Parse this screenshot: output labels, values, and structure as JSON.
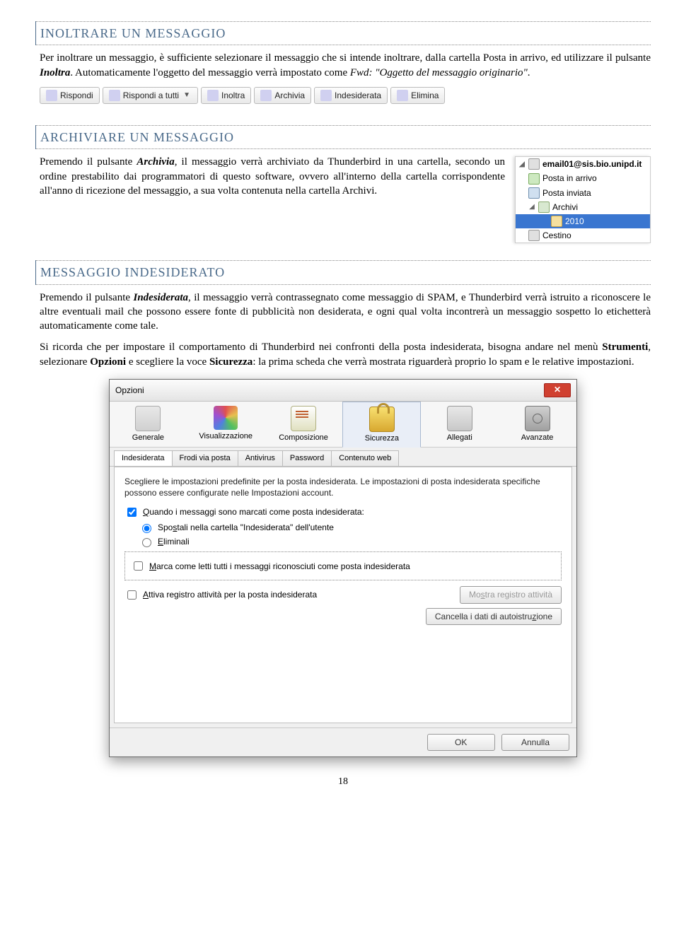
{
  "sections": {
    "forward": {
      "title": "INOLTRARE UN MESSAGGIO",
      "p1_a": "Per inoltrare un messaggio, è sufficiente selezionare il messaggio che si intende inoltrare, dalla cartella Posta in arrivo, ed utilizzare il pulsante ",
      "p1_b": "Inoltra",
      "p1_c": ". Automaticamente l'oggetto del messaggio verrà impostato come ",
      "p1_d": "Fwd: \"Oggetto del messaggio originario\"",
      "p1_e": "."
    },
    "archive": {
      "title": "ARCHIVIARE UN MESSAGGIO",
      "p1_a": "Premendo il pulsante ",
      "p1_b": "Archivia",
      "p1_c": ", il messaggio verrà archiviato da Thunderbird in una cartella, secondo un ordine prestabilito dai programmatori di questo software, ovvero all'interno della cartella corrispondente all'anno di ricezione del messaggio, a sua volta contenuta nella cartella Archivi."
    },
    "junk": {
      "title": "MESSAGGIO INDESIDERATO",
      "p1_a": "Premendo il pulsante  ",
      "p1_b": "Indesiderata",
      "p1_c": ", il messaggio verrà contrassegnato come messaggio di SPAM, e Thunderbird verrà istruito a riconoscere le altre eventuali mail che possono essere fonte di pubblicità non desiderata, e ogni qual volta incontrerà un messaggio sospetto lo etichetterà automaticamente come tale.",
      "p2_a": "Si ricorda che per impostare il comportamento di Thunderbird nei confronti della posta indesiderata, bisogna andare nel menù ",
      "p2_b": "Strumenti",
      "p2_c": ", selezionare ",
      "p2_d": "Opzioni",
      "p2_e": " e scegliere la voce ",
      "p2_f": "Sicurezza",
      "p2_g": ": la prima scheda che verrà mostrata riguarderà proprio lo spam e le relative impostazioni."
    }
  },
  "toolbar": {
    "reply": "Rispondi",
    "reply_all": "Rispondi a tutti",
    "forward": "Inoltra",
    "archive": "Archivia",
    "junk": "Indesiderata",
    "delete": "Elimina"
  },
  "folders": {
    "account": "email01@sis.bio.unipd.it",
    "inbox": "Posta in arrivo",
    "sent": "Posta inviata",
    "archives": "Archivi",
    "year": "2010",
    "trash": "Cestino"
  },
  "dialog": {
    "title": "Opzioni",
    "categories": {
      "general": "Generale",
      "display": "Visualizzazione",
      "compose": "Composizione",
      "security": "Sicurezza",
      "attach": "Allegati",
      "advanced": "Avanzate"
    },
    "subtabs": {
      "junk": "Indesiderata",
      "fraud": "Frodi via posta",
      "antivirus": "Antivirus",
      "password": "Password",
      "web": "Contenuto web"
    },
    "desc": "Scegliere le impostazioni predefinite per la posta indesiderata. Le impostazioni di posta indesiderata specifiche possono essere configurate nelle Impostazioni account.",
    "chk_when_marked_pre": "Q",
    "chk_when_marked": "uando i messaggi sono marcati come posta indesiderata:",
    "rad_move_pre": "Spo",
    "rad_move_u": "s",
    "rad_move_post": "tali nella cartella \"Indesiderata\" dell'utente",
    "rad_delete_u": "E",
    "rad_delete_post": "liminali",
    "chk_mark_read_u": "M",
    "chk_mark_read": "arca come letti tutti i messaggi riconosciuti come posta indesiderata",
    "chk_log_u": "A",
    "chk_log": "ttiva registro attività per la posta indesiderata",
    "btn_show_log_pre": "Mo",
    "btn_show_log_u": "s",
    "btn_show_log_post": "tra registro attività",
    "btn_reset_pre": "Cancella i dati di autoistru",
    "btn_reset_u": "z",
    "btn_reset_post": "ione",
    "ok": "OK",
    "cancel": "Annulla"
  },
  "page_number": "18"
}
